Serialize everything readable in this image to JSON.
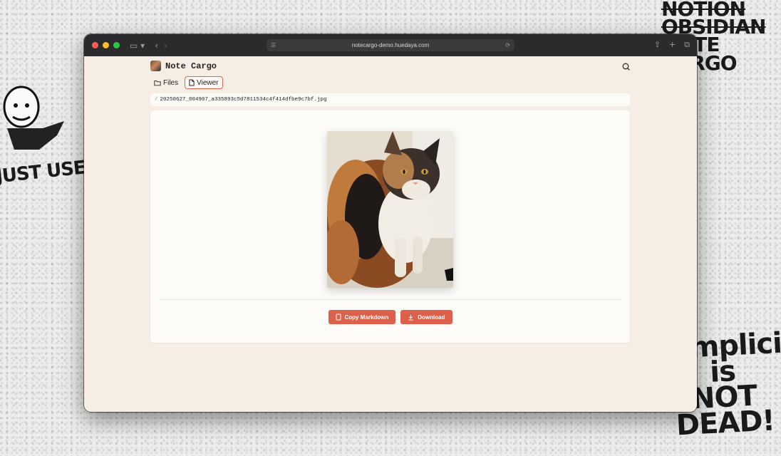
{
  "browser": {
    "url": "notecargo-demo.huedaya.com"
  },
  "app": {
    "title": "Note Cargo"
  },
  "tabs": [
    {
      "label": "Files",
      "active": false
    },
    {
      "label": "Viewer",
      "active": true
    }
  ],
  "breadcrumb": {
    "separator": "/",
    "path": "20250627_004907_a335893c5d7811534c4f414dfbe9c7bf.jpg"
  },
  "actions": {
    "copy_markdown": "Copy Markdown",
    "download": "Download"
  },
  "backdrop": {
    "left_text": "JUST USE.MD",
    "right_top_lines": [
      "NOTION",
      "OBSIDIAN",
      "NOTE",
      "CARGO"
    ],
    "right_bottom_lines": [
      "Simplicity",
      "is",
      "NOT DEAD!"
    ]
  },
  "colors": {
    "accent": "#dc604b",
    "page_bg": "#f6eee5",
    "titlebar": "#2b2a2d"
  }
}
